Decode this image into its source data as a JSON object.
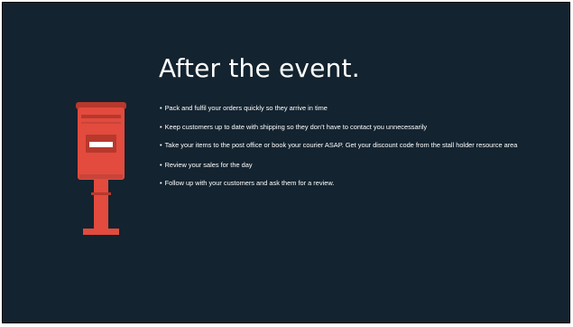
{
  "slide": {
    "title": "After the event.",
    "bullet_glyph": "•",
    "bullets": [
      "Pack and fulfil your orders quickly so they arrive in time",
      "Keep customers up to date with shipping so they don’t have to contact you unnecessarily",
      "Take your items to the post office or book your courier ASAP. Get your discount code from the stall holder resource area",
      "Review your sales for the day",
      "Follow up with your customers and ask them for a review."
    ],
    "illustration": "post-box-icon"
  },
  "colors": {
    "background": "#13232f",
    "text": "#ffffff",
    "postbox_red": "#e24b3d",
    "postbox_dark": "#b8382d"
  }
}
